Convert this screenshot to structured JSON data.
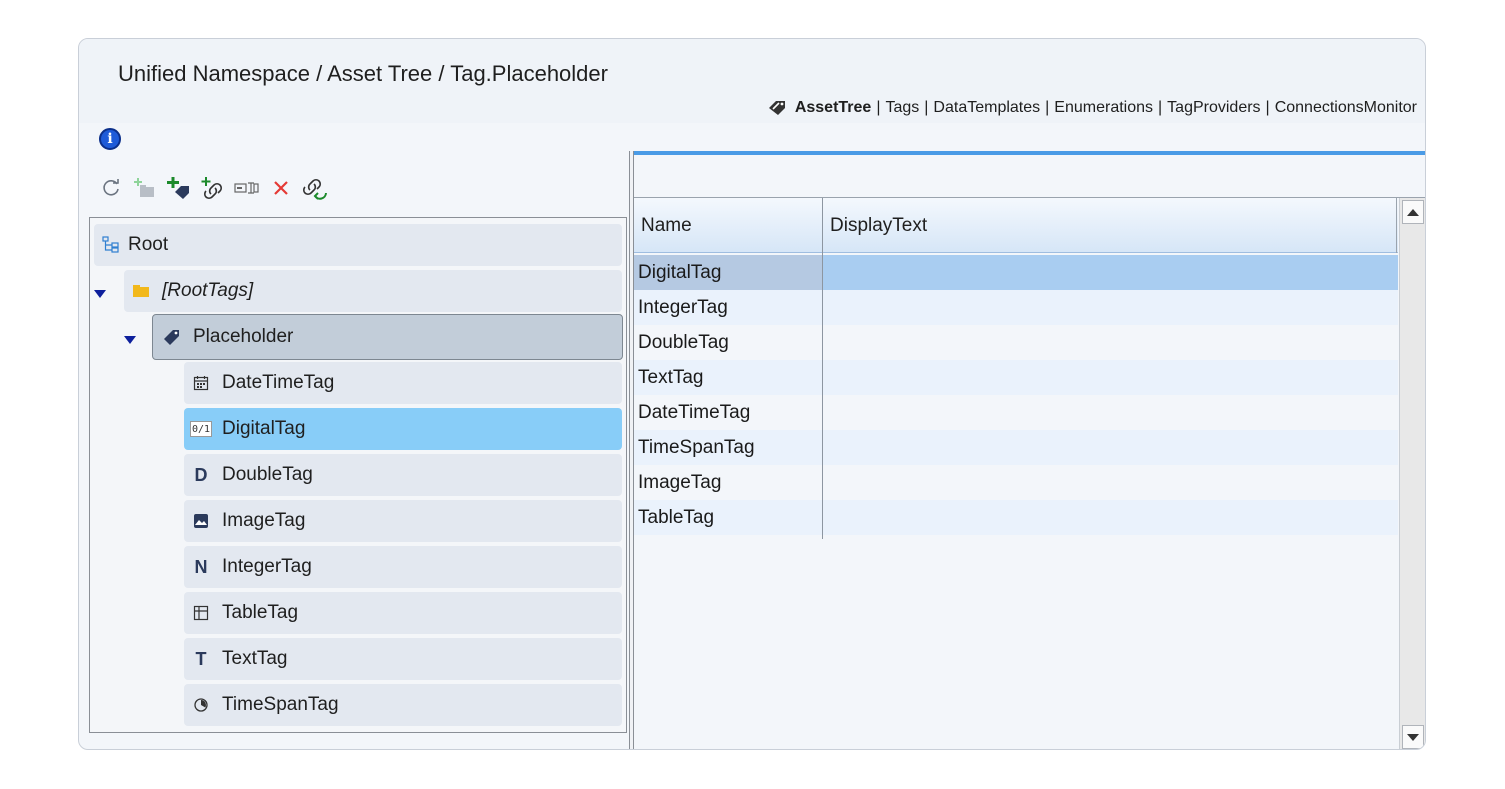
{
  "header": {
    "breadcrumb": "Unified Namespace / Asset Tree / Tag.Placeholder"
  },
  "nav": {
    "links": [
      "AssetTree",
      "Tags",
      "DataTemplates",
      "Enumerations",
      "TagProviders",
      "ConnectionsMonitor"
    ],
    "active": "AssetTree",
    "separator": "|"
  },
  "info_icon": "i",
  "toolbar": {
    "icons": [
      "refresh-icon",
      "new-folder-icon",
      "new-tag-icon",
      "new-link-icon",
      "rename-icon",
      "delete-icon",
      "link-refresh-icon"
    ]
  },
  "tree": {
    "root": "Root",
    "root_tags": "[RootTags]",
    "placeholder": "Placeholder",
    "children": [
      {
        "label": "DateTimeTag",
        "icon": "calendar-icon"
      },
      {
        "label": "DigitalTag",
        "icon": "digital-icon",
        "badge": "0/1"
      },
      {
        "label": "DoubleTag",
        "icon": "double-icon",
        "badge": "D"
      },
      {
        "label": "ImageTag",
        "icon": "image-icon"
      },
      {
        "label": "IntegerTag",
        "icon": "integer-icon",
        "badge": "N"
      },
      {
        "label": "TableTag",
        "icon": "table-icon"
      },
      {
        "label": "TextTag",
        "icon": "text-icon",
        "badge": "T"
      },
      {
        "label": "TimeSpanTag",
        "icon": "timespan-icon"
      }
    ],
    "selected": "DigitalTag"
  },
  "grid": {
    "columns": [
      "Name",
      "DisplayText"
    ],
    "rows": [
      [
        "DigitalTag",
        ""
      ],
      [
        "IntegerTag",
        ""
      ],
      [
        "DoubleTag",
        ""
      ],
      [
        "TextTag",
        ""
      ],
      [
        "DateTimeTag",
        ""
      ],
      [
        "TimeSpanTag",
        ""
      ],
      [
        "ImageTag",
        ""
      ],
      [
        "TableTag",
        ""
      ]
    ],
    "selected_row": 0
  },
  "colors": {
    "selected_tree": "#88cdf8",
    "accent": "#4a9be6",
    "arrow": "#0d1f9c",
    "delete": "#e53935",
    "add": "#1c8a2b"
  }
}
